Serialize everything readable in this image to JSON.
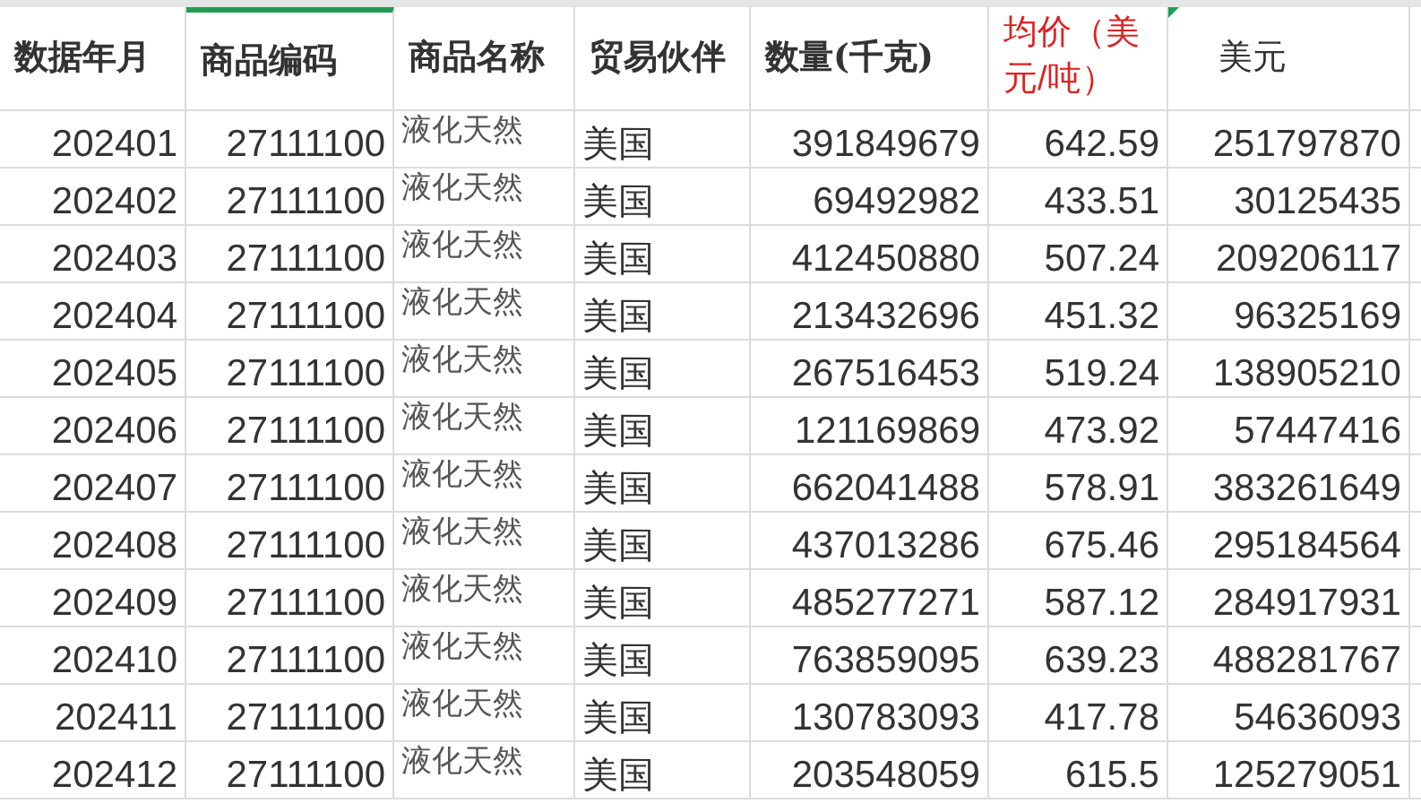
{
  "table": {
    "columns": [
      {
        "label": "数据年月",
        "selected": false,
        "color": "#333333",
        "flagged": false
      },
      {
        "label": "商品编码",
        "selected": true,
        "color": "#333333",
        "flagged": false
      },
      {
        "label": "商品名称",
        "selected": false,
        "color": "#333333",
        "flagged": false
      },
      {
        "label": "贸易伙伴",
        "selected": false,
        "color": "#333333",
        "flagged": false
      },
      {
        "label": "数量(千克)",
        "selected": false,
        "color": "#333333",
        "flagged": false
      },
      {
        "label": "均价（美元/吨）",
        "selected": false,
        "color": "#e02020",
        "flagged": false
      },
      {
        "label": "美元",
        "selected": false,
        "color": "#333333",
        "flagged": true
      }
    ],
    "rows": [
      [
        "202401",
        "27111100",
        "液化天然",
        "美国",
        "391849679",
        "642.59",
        "251797870"
      ],
      [
        "202402",
        "27111100",
        "液化天然",
        "美国",
        "69492982",
        "433.51",
        "30125435"
      ],
      [
        "202403",
        "27111100",
        "液化天然",
        "美国",
        "412450880",
        "507.24",
        "209206117"
      ],
      [
        "202404",
        "27111100",
        "液化天然",
        "美国",
        "213432696",
        "451.32",
        "96325169"
      ],
      [
        "202405",
        "27111100",
        "液化天然",
        "美国",
        "267516453",
        "519.24",
        "138905210"
      ],
      [
        "202406",
        "27111100",
        "液化天然",
        "美国",
        "121169869",
        "473.92",
        "57447416"
      ],
      [
        "202407",
        "27111100",
        "液化天然",
        "美国",
        "662041488",
        "578.91",
        "383261649"
      ],
      [
        "202408",
        "27111100",
        "液化天然",
        "美国",
        "437013286",
        "675.46",
        "295184564"
      ],
      [
        "202409",
        "27111100",
        "液化天然",
        "美国",
        "485277271",
        "587.12",
        "284917931"
      ],
      [
        "202410",
        "27111100",
        "液化天然",
        "美国",
        "763859095",
        "639.23",
        "488281767"
      ],
      [
        "202411",
        "27111100",
        "液化天然",
        "美国",
        "130783093",
        "417.78",
        "54636093"
      ],
      [
        "202412",
        "27111100",
        "液化天然",
        "美国",
        "203548059",
        "615.5",
        "125279051"
      ]
    ]
  }
}
